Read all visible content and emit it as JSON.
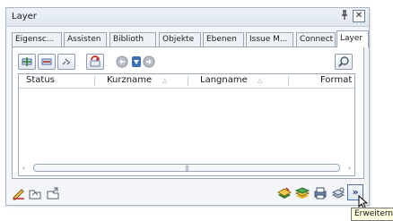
{
  "window": {
    "title": "Layer",
    "pin_glyph": "ₜ",
    "close_glyph": "✕"
  },
  "tabs": [
    {
      "label": "Eigensc..."
    },
    {
      "label": "Assisten"
    },
    {
      "label": "Biblioth"
    },
    {
      "label": "Objekte"
    },
    {
      "label": "Ebenen"
    },
    {
      "label": "Issue M..."
    },
    {
      "label": "Connect"
    },
    {
      "label": "Layer",
      "active": true
    }
  ],
  "toolbar": {
    "buttons": [
      "add-layer-icon",
      "remove-layer-icon",
      "link-icon",
      "refresh-icon",
      "nav-back-icon",
      "filter-down-icon",
      "nav-forward-icon"
    ],
    "search_icon": "search-icon"
  },
  "grid": {
    "columns": [
      {
        "label": "Status"
      },
      {
        "label": "Kurzname"
      },
      {
        "label": "Langname"
      },
      {
        "label": "Format"
      }
    ],
    "sort_glyph": "△",
    "rows": []
  },
  "bottom": {
    "left_icons": [
      "pencil-icon",
      "folder-icon",
      "export-icon"
    ],
    "right_icons": [
      "layers-icon",
      "layer-stack-icon",
      "print-icon",
      "settings-icon"
    ],
    "expand_glyph": "»"
  },
  "tooltip": {
    "text": "Erweitern"
  },
  "colors": {
    "panel_bg": "#f3f5f8",
    "border": "#9aa7b7",
    "expand_border": "#4e6fa3"
  }
}
